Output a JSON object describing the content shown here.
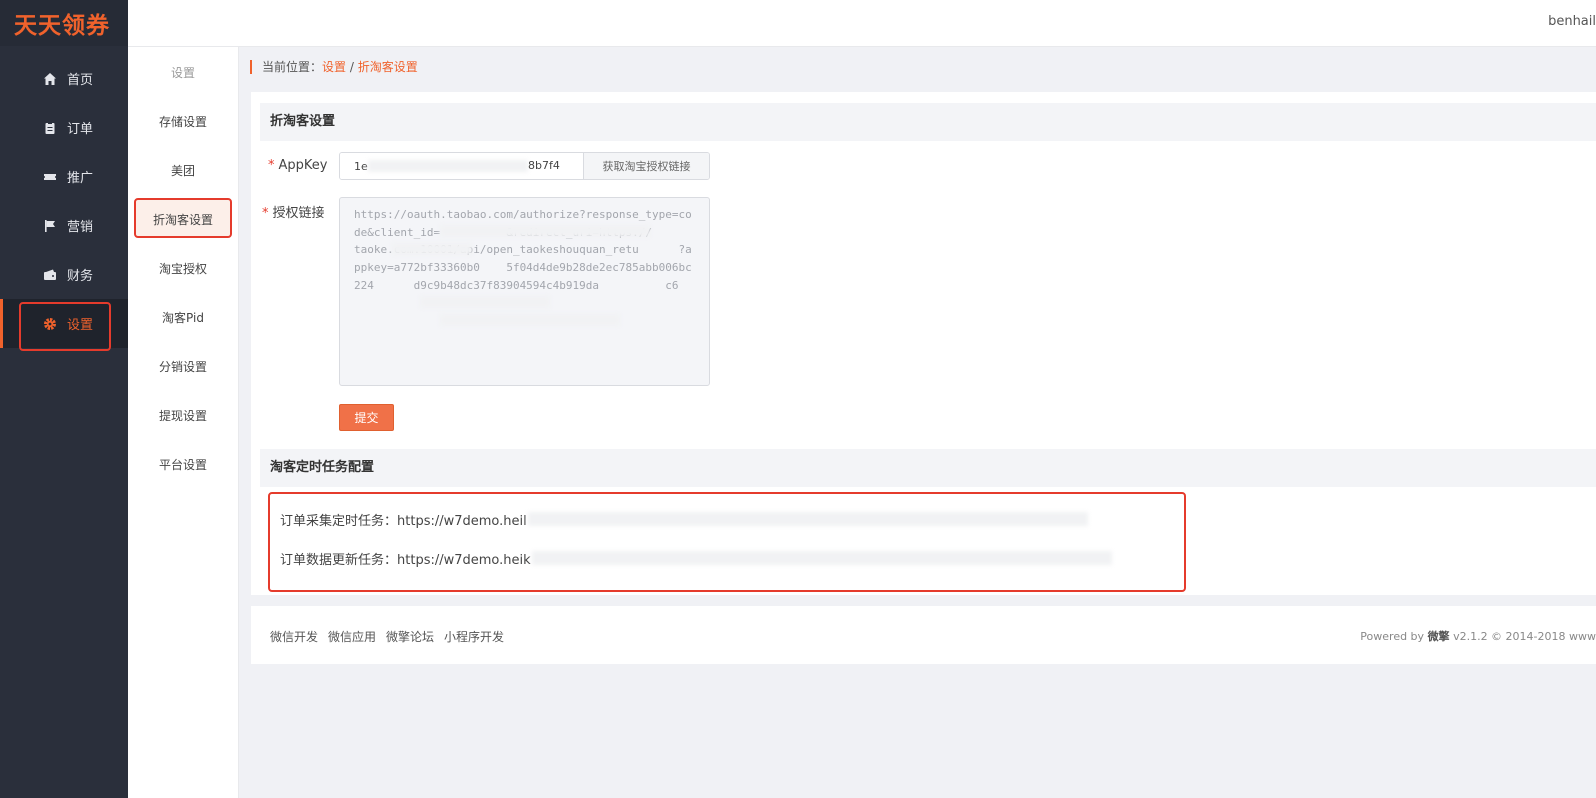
{
  "app": {
    "logo": "天天领券",
    "username": "benhail"
  },
  "sidebar": {
    "items": [
      {
        "label": "首页",
        "icon": "home-icon"
      },
      {
        "label": "订单",
        "icon": "clipboard-icon"
      },
      {
        "label": "推广",
        "icon": "ticket-icon"
      },
      {
        "label": "营销",
        "icon": "flag-icon"
      },
      {
        "label": "财务",
        "icon": "wallet-icon"
      },
      {
        "label": "设置",
        "icon": "gear-icon",
        "active": true
      }
    ]
  },
  "subnav": {
    "header": "设置",
    "items": [
      "存储设置",
      "美团",
      "折淘客设置",
      "淘宝授权",
      "淘客Pid",
      "分销设置",
      "提现设置",
      "平台设置"
    ],
    "active": "折淘客设置"
  },
  "breadcrumb": {
    "prefix": "当前位置：",
    "parent": "设置",
    "sep": " / ",
    "current": "折淘客设置"
  },
  "form": {
    "section_title": "折淘客设置",
    "appkey_label": "AppKey",
    "appkey_value": "1e",
    "appkey_value_end": "8b7f4",
    "get_link_button": "获取淘宝授权链接",
    "auth_label": "授权链接",
    "auth_value": "https://oauth.taobao.com/authorize?response_type=code&client_id=          &redirect_uri=https://          taoke.com:10001/api/open_taokeshouquan_retu      ?appkey=a772bf33360b0    5f04d4de9b28de2ec785abb006bc224      d9c9b48dc37f83904594c4b919da          c6",
    "submit_button": "提交"
  },
  "tasks": {
    "section_title": "淘客定时任务配置",
    "order_collect_label": "订单采集定时任务：",
    "order_collect_url": "https://w7demo.heil",
    "order_update_label": "订单数据更新任务：",
    "order_update_url": "https://w7demo.heik"
  },
  "footer": {
    "links": [
      "微信开发",
      "微信应用",
      "微擎论坛",
      "小程序开发"
    ],
    "powered_prefix": "Powered by",
    "brand": "微擎",
    "version": "v2.1.2 © 2014-2018 www"
  },
  "colors": {
    "accent": "#f0622c",
    "sidebar_bg": "#2a2f3b",
    "highlight_box": "#e53b2c"
  }
}
